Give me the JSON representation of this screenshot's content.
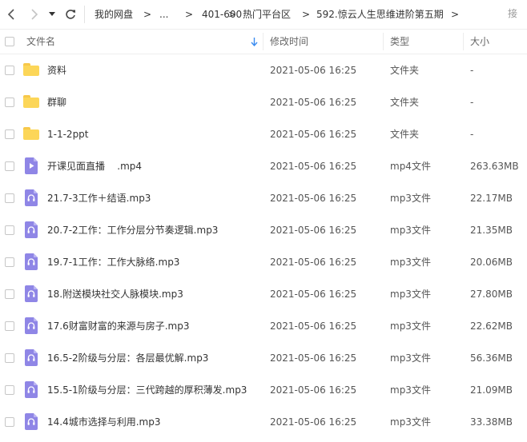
{
  "nav": {
    "breadcrumbs": [
      "我的网盘",
      "...",
      "401-600",
      "热门平台区",
      "592.惊云人生思维进阶第五期"
    ],
    "separator": ">",
    "right_fragment": "接"
  },
  "header": {
    "name": "文件名",
    "modified": "修改时间",
    "type": "类型",
    "size": "大小"
  },
  "colors": {
    "folder": "#fcd658",
    "file_icon": "#8f86e6",
    "sort_arrow": "#3b8cf0"
  },
  "files": [
    {
      "name": "资料",
      "date": "2021-05-06 16:25",
      "type": "文件夹",
      "size": "-",
      "icon": "folder-icon"
    },
    {
      "name": "群聊",
      "date": "2021-05-06 16:25",
      "type": "文件夹",
      "size": "-",
      "icon": "folder-icon"
    },
    {
      "name": "1-1-2ppt",
      "date": "2021-05-06 16:25",
      "type": "文件夹",
      "size": "-",
      "icon": "folder-icon"
    },
    {
      "name": "开课见面直播    .mp4",
      "date": "2021-05-06 16:25",
      "type": "mp4文件",
      "size": "263.63MB",
      "icon": "video-file-icon"
    },
    {
      "name": "21.7-3工作＋结语.mp3",
      "date": "2021-05-06 16:25",
      "type": "mp3文件",
      "size": "22.17MB",
      "icon": "audio-file-icon"
    },
    {
      "name": "20.7-2工作：工作分层分节奏逻辑.mp3",
      "date": "2021-05-06 16:25",
      "type": "mp3文件",
      "size": "21.35MB",
      "icon": "audio-file-icon"
    },
    {
      "name": "19.7-1工作：工作大脉络.mp3",
      "date": "2021-05-06 16:25",
      "type": "mp3文件",
      "size": "20.06MB",
      "icon": "audio-file-icon"
    },
    {
      "name": "18.附送模块社交人脉模块.mp3",
      "date": "2021-05-06 16:25",
      "type": "mp3文件",
      "size": "27.80MB",
      "icon": "audio-file-icon"
    },
    {
      "name": "17.6财富财富的来源与房子.mp3",
      "date": "2021-05-06 16:25",
      "type": "mp3文件",
      "size": "22.62MB",
      "icon": "audio-file-icon"
    },
    {
      "name": "16.5-2阶级与分层：各层最优解.mp3",
      "date": "2021-05-06 16:25",
      "type": "mp3文件",
      "size": "56.36MB",
      "icon": "audio-file-icon"
    },
    {
      "name": "15.5-1阶级与分层：三代跨越的厚积薄发.mp3",
      "date": "2021-05-06 16:25",
      "type": "mp3文件",
      "size": "21.09MB",
      "icon": "audio-file-icon"
    },
    {
      "name": "14.4城市选择与利用.mp3",
      "date": "2021-05-06 16:25",
      "type": "mp3文件",
      "size": "33.38MB",
      "icon": "audio-file-icon"
    }
  ]
}
